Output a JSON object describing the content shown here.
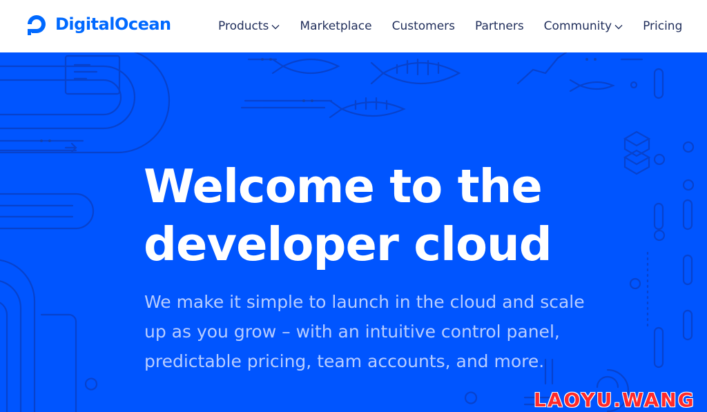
{
  "brand": {
    "name": "DigitalOcean",
    "color": "#0069ff",
    "icon": "digitalocean-logo-icon"
  },
  "nav": {
    "items": [
      {
        "label": "Products",
        "dropdown": true
      },
      {
        "label": "Marketplace",
        "dropdown": false
      },
      {
        "label": "Customers",
        "dropdown": false
      },
      {
        "label": "Partners",
        "dropdown": false
      },
      {
        "label": "Community",
        "dropdown": true
      },
      {
        "label": "Pricing",
        "dropdown": false
      }
    ]
  },
  "hero": {
    "title_line1": "Welcome to the",
    "title_line2": "developer cloud",
    "subtitle": "We make it simple to launch in the cloud and scale up as you grow – with an intuitive control panel, predictable pricing, team accounts, and more.",
    "background_color": "#0055ff"
  },
  "watermark": {
    "text": "LAOYU.WANG",
    "color": "#ff2a2a"
  }
}
